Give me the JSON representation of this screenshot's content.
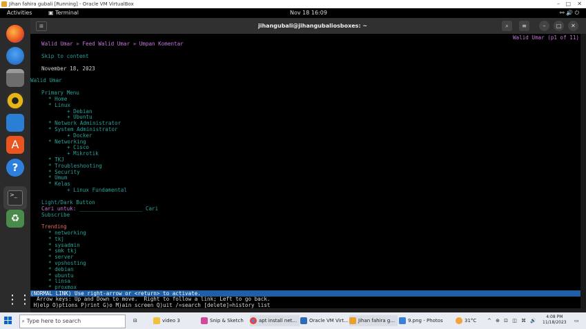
{
  "vbox": {
    "title": "Jihan fahira gubali [Running] - Oracle VM VirtualBox"
  },
  "gnome": {
    "activities": "Activities",
    "app": "Terminal",
    "clock": "Nov 18  16:09"
  },
  "terminal": {
    "title": "jihangubali@jihangubaliosboxes: ~"
  },
  "page": {
    "header": "Walid Umar » Feed Walid Umar » Umpan Komentar",
    "page_indicator": "Walid Umar (p1 of 11)",
    "skip": "Skip to content",
    "date": "November 18, 2023",
    "site": "Walid Umar",
    "menu_title": "Primary Menu",
    "menu": [
      {
        "label": "* Home",
        "indent": 1
      },
      {
        "label": "* Linux",
        "indent": 1
      },
      {
        "label": "+ Debian",
        "indent": 2
      },
      {
        "label": "+ Ubuntu",
        "indent": 2
      },
      {
        "label": "* Network Administrator",
        "indent": 1
      },
      {
        "label": "* System Administrator",
        "indent": 1
      },
      {
        "label": "+ Docker",
        "indent": 2
      },
      {
        "label": "* Networking",
        "indent": 1
      },
      {
        "label": "+ Cisco",
        "indent": 2
      },
      {
        "label": "+ Mikrotik",
        "indent": 2
      },
      {
        "label": "* TKJ",
        "indent": 1
      },
      {
        "label": "* Troubleshooting",
        "indent": 1
      },
      {
        "label": "* Security",
        "indent": 1
      },
      {
        "label": "* Umum",
        "indent": 1
      },
      {
        "label": "* Kelas",
        "indent": 1
      },
      {
        "label": "+ Linux Fundamental",
        "indent": 2
      }
    ],
    "light_dark": "Light/Dark Button",
    "search_label": "Cari untuk:",
    "search_field": "____________________",
    "search_button": "Cari",
    "subscribe": "Subscribe",
    "trending_title": "Trending",
    "trending": [
      "* networking",
      "* tkj",
      "* sysadmin",
      "* smk tkj",
      "* server",
      "* vpshosting",
      "* debian",
      "* ubuntu",
      "* linsa",
      "* proxmox"
    ]
  },
  "status": "(NORMAL LINK) Use right-arrow or <return> to activate.",
  "help": [
    "  Arrow keys: Up and Down to move.  Right to follow a link; Left to go back.",
    " H)elp O)ptions P)rint G)o M)ain screen Q)uit /=search [delete]=history list"
  ],
  "taskbar": {
    "search_placeholder": "Type here to search",
    "items": [
      "video 3",
      "Snip & Sketch",
      "apt install net...",
      "Oracle VM Virt...",
      "Jihan fahira g...",
      "9.png - Photos"
    ],
    "weather": "31°C",
    "time": "4:08 PM",
    "date": "11/18/2023"
  },
  "colors": {
    "status_bg": "#1f5fa8",
    "link": "#2aa198",
    "trending": "#e06c60",
    "header": "#c678dd"
  }
}
